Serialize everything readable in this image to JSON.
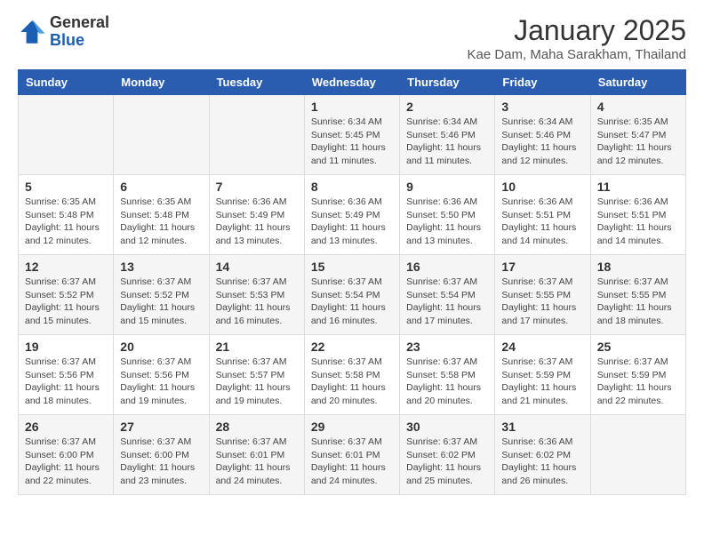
{
  "logo": {
    "general": "General",
    "blue": "Blue"
  },
  "header": {
    "month": "January 2025",
    "location": "Kae Dam, Maha Sarakham, Thailand"
  },
  "weekdays": [
    "Sunday",
    "Monday",
    "Tuesday",
    "Wednesday",
    "Thursday",
    "Friday",
    "Saturday"
  ],
  "weeks": [
    [
      {
        "day": "",
        "info": ""
      },
      {
        "day": "",
        "info": ""
      },
      {
        "day": "",
        "info": ""
      },
      {
        "day": "1",
        "info": "Sunrise: 6:34 AM\nSunset: 5:45 PM\nDaylight: 11 hours\nand 11 minutes."
      },
      {
        "day": "2",
        "info": "Sunrise: 6:34 AM\nSunset: 5:46 PM\nDaylight: 11 hours\nand 11 minutes."
      },
      {
        "day": "3",
        "info": "Sunrise: 6:34 AM\nSunset: 5:46 PM\nDaylight: 11 hours\nand 12 minutes."
      },
      {
        "day": "4",
        "info": "Sunrise: 6:35 AM\nSunset: 5:47 PM\nDaylight: 11 hours\nand 12 minutes."
      }
    ],
    [
      {
        "day": "5",
        "info": "Sunrise: 6:35 AM\nSunset: 5:48 PM\nDaylight: 11 hours\nand 12 minutes."
      },
      {
        "day": "6",
        "info": "Sunrise: 6:35 AM\nSunset: 5:48 PM\nDaylight: 11 hours\nand 12 minutes."
      },
      {
        "day": "7",
        "info": "Sunrise: 6:36 AM\nSunset: 5:49 PM\nDaylight: 11 hours\nand 13 minutes."
      },
      {
        "day": "8",
        "info": "Sunrise: 6:36 AM\nSunset: 5:49 PM\nDaylight: 11 hours\nand 13 minutes."
      },
      {
        "day": "9",
        "info": "Sunrise: 6:36 AM\nSunset: 5:50 PM\nDaylight: 11 hours\nand 13 minutes."
      },
      {
        "day": "10",
        "info": "Sunrise: 6:36 AM\nSunset: 5:51 PM\nDaylight: 11 hours\nand 14 minutes."
      },
      {
        "day": "11",
        "info": "Sunrise: 6:36 AM\nSunset: 5:51 PM\nDaylight: 11 hours\nand 14 minutes."
      }
    ],
    [
      {
        "day": "12",
        "info": "Sunrise: 6:37 AM\nSunset: 5:52 PM\nDaylight: 11 hours\nand 15 minutes."
      },
      {
        "day": "13",
        "info": "Sunrise: 6:37 AM\nSunset: 5:52 PM\nDaylight: 11 hours\nand 15 minutes."
      },
      {
        "day": "14",
        "info": "Sunrise: 6:37 AM\nSunset: 5:53 PM\nDaylight: 11 hours\nand 16 minutes."
      },
      {
        "day": "15",
        "info": "Sunrise: 6:37 AM\nSunset: 5:54 PM\nDaylight: 11 hours\nand 16 minutes."
      },
      {
        "day": "16",
        "info": "Sunrise: 6:37 AM\nSunset: 5:54 PM\nDaylight: 11 hours\nand 17 minutes."
      },
      {
        "day": "17",
        "info": "Sunrise: 6:37 AM\nSunset: 5:55 PM\nDaylight: 11 hours\nand 17 minutes."
      },
      {
        "day": "18",
        "info": "Sunrise: 6:37 AM\nSunset: 5:55 PM\nDaylight: 11 hours\nand 18 minutes."
      }
    ],
    [
      {
        "day": "19",
        "info": "Sunrise: 6:37 AM\nSunset: 5:56 PM\nDaylight: 11 hours\nand 18 minutes."
      },
      {
        "day": "20",
        "info": "Sunrise: 6:37 AM\nSunset: 5:56 PM\nDaylight: 11 hours\nand 19 minutes."
      },
      {
        "day": "21",
        "info": "Sunrise: 6:37 AM\nSunset: 5:57 PM\nDaylight: 11 hours\nand 19 minutes."
      },
      {
        "day": "22",
        "info": "Sunrise: 6:37 AM\nSunset: 5:58 PM\nDaylight: 11 hours\nand 20 minutes."
      },
      {
        "day": "23",
        "info": "Sunrise: 6:37 AM\nSunset: 5:58 PM\nDaylight: 11 hours\nand 20 minutes."
      },
      {
        "day": "24",
        "info": "Sunrise: 6:37 AM\nSunset: 5:59 PM\nDaylight: 11 hours\nand 21 minutes."
      },
      {
        "day": "25",
        "info": "Sunrise: 6:37 AM\nSunset: 5:59 PM\nDaylight: 11 hours\nand 22 minutes."
      }
    ],
    [
      {
        "day": "26",
        "info": "Sunrise: 6:37 AM\nSunset: 6:00 PM\nDaylight: 11 hours\nand 22 minutes."
      },
      {
        "day": "27",
        "info": "Sunrise: 6:37 AM\nSunset: 6:00 PM\nDaylight: 11 hours\nand 23 minutes."
      },
      {
        "day": "28",
        "info": "Sunrise: 6:37 AM\nSunset: 6:01 PM\nDaylight: 11 hours\nand 24 minutes."
      },
      {
        "day": "29",
        "info": "Sunrise: 6:37 AM\nSunset: 6:01 PM\nDaylight: 11 hours\nand 24 minutes."
      },
      {
        "day": "30",
        "info": "Sunrise: 6:37 AM\nSunset: 6:02 PM\nDaylight: 11 hours\nand 25 minutes."
      },
      {
        "day": "31",
        "info": "Sunrise: 6:36 AM\nSunset: 6:02 PM\nDaylight: 11 hours\nand 26 minutes."
      },
      {
        "day": "",
        "info": ""
      }
    ]
  ]
}
